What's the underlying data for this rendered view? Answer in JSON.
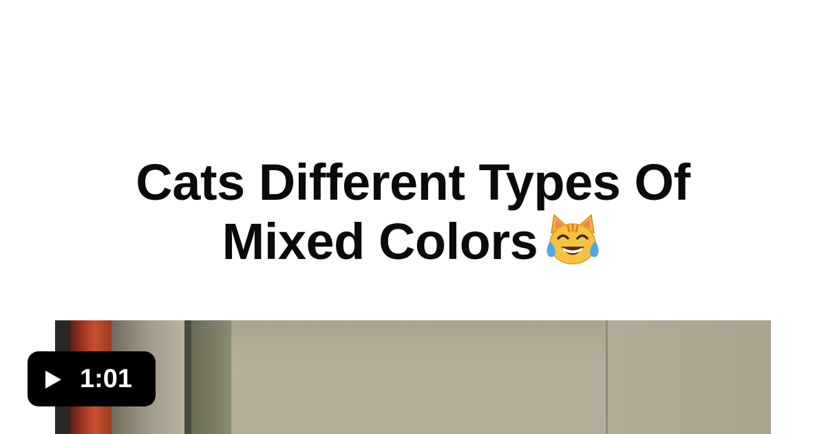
{
  "post": {
    "title_line1": "Cats Different Types Of",
    "title_line2": "Mixed Colors",
    "title_emoji": "cat-face-with-tears-of-joy-icon"
  },
  "video": {
    "duration": "1:01",
    "play_icon": "play-icon"
  },
  "colors": {
    "background": "#ffffff",
    "title_text": "#0a0a0a",
    "badge_background": "#000000",
    "badge_text": "#ffffff"
  }
}
